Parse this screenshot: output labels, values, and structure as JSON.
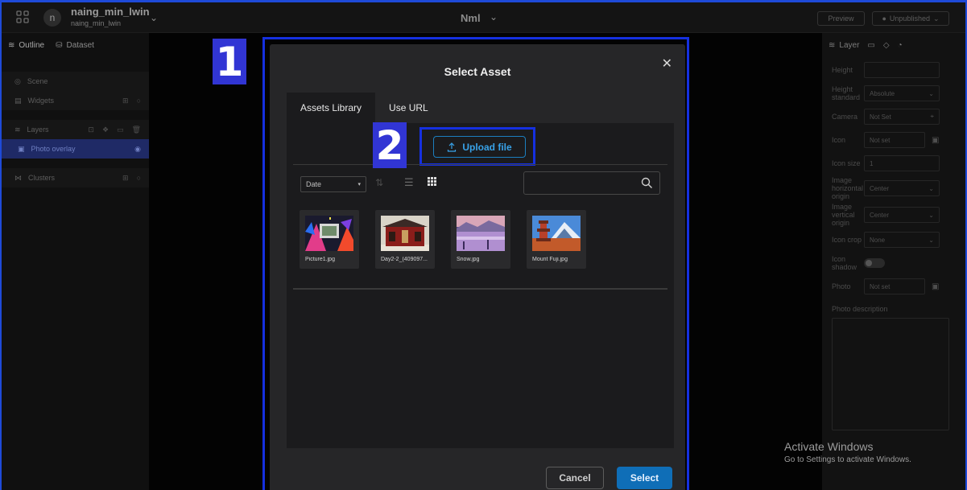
{
  "topbar": {
    "username": "naing_min_lwin",
    "username_sub": "naing_min_lwin",
    "avatar_letter": "n",
    "project_title": "Nml",
    "preview_label": "Preview",
    "publish_status": "Unpublished"
  },
  "left_panel": {
    "tabs": [
      "Outline",
      "Dataset"
    ],
    "items": {
      "scene": "Scene",
      "widgets": "Widgets",
      "layers": "Layers",
      "photo_overlay": "Photo overlay",
      "clusters": "Clusters"
    }
  },
  "right_panel": {
    "tab_layer": "Layer",
    "fields": {
      "height_label": "Height",
      "height_standard_label": "Height standard",
      "height_standard_value": "Absolute",
      "camera_label": "Camera",
      "camera_value": "Not Set",
      "icon_label": "Icon",
      "icon_value": "Not set",
      "icon_size_label": "Icon size",
      "icon_size_value": "1",
      "image_h_origin_label": "Image horizontal origin",
      "image_h_origin_value": "Center",
      "image_v_origin_label": "Image vertical origin",
      "image_v_origin_value": "Center",
      "icon_crop_label": "Icon crop",
      "icon_crop_value": "None",
      "icon_shadow_label": "Icon shadow",
      "photo_label": "Photo",
      "photo_value": "Not set",
      "photo_description_label": "Photo description"
    }
  },
  "modal": {
    "title": "Select Asset",
    "tabs": [
      "Assets Library",
      "Use URL"
    ],
    "upload_label": "Upload file",
    "sort_value": "Date",
    "search_placeholder": "",
    "assets": [
      {
        "name": "Picture1.jpg"
      },
      {
        "name": "Day2-2_(409097..."
      },
      {
        "name": "Snow.jpg"
      },
      {
        "name": "Mount Fuji.jpg"
      }
    ],
    "cancel_label": "Cancel",
    "select_label": "Select"
  },
  "annotations": {
    "badge1": "1",
    "badge2": "2"
  },
  "watermark": {
    "line1": "Activate Windows",
    "line2": "Go to Settings to activate Windows."
  },
  "colors": {
    "accent": "#1c7fbf",
    "select_button": "#0f6eb7",
    "highlight": "#1530e0",
    "badge": "#3135d4"
  }
}
